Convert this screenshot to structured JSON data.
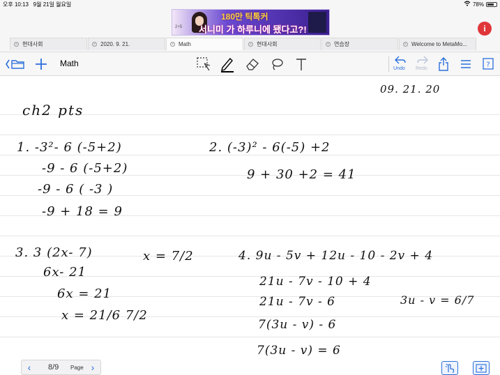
{
  "status": {
    "time": "오후 10:13",
    "date": "9월 21일 월요일",
    "battery": "78%",
    "battery_level": 0.78
  },
  "ad": {
    "line1": "180만 틱톡커",
    "line2": "서니미 가 하루니에 됐다고?!",
    "small": "2+5"
  },
  "tabs": [
    {
      "label": "현대사회",
      "active": false
    },
    {
      "label": "2020. 9. 21.",
      "active": false
    },
    {
      "label": "Math",
      "active": true
    },
    {
      "label": "현대사회",
      "active": false
    },
    {
      "label": "연습장",
      "active": false
    },
    {
      "label": "Welcome to MetaMo...",
      "active": false
    }
  ],
  "toolbar": {
    "doc_title": "Math",
    "undo_label": "Undo",
    "redo_label": "Redo",
    "accent": "#2a6edb",
    "icons": [
      "folder-icon",
      "plus-icon",
      "lasso-select-icon",
      "pen-icon",
      "eraser-icon",
      "lasso-icon",
      "text-icon",
      "undo-icon",
      "redo-icon",
      "share-icon",
      "list-icon",
      "help-icon"
    ]
  },
  "note": {
    "date": "09. 21. 20",
    "heading": "ch2  pts",
    "p1": [
      "1.  -3²- 6 (-5+2)",
      "-9 - 6 (-5+2)",
      "-9 - 6 ( -3 )",
      "-9 + 18  =  9"
    ],
    "p2": [
      "2.  (-3)² - 6(-5) +2",
      "9 + 30 +2 = 41"
    ],
    "p3": [
      "3. 3 (2x- 7)",
      "6x- 21",
      "6x = 21",
      "x =  21/6  7/2"
    ],
    "p3_answer": "x = 7/2",
    "p4": [
      "4.  9u - 5v + 12u - 10 - 2v + 4",
      "21u - 7v - 10 + 4",
      "21u - 7v - 6",
      "7(3u - v) - 6",
      "7(3u - v) = 6"
    ],
    "p4_answer": "3u - v = 6/7"
  },
  "pagenav": {
    "current": "8/9",
    "word": "Page"
  }
}
